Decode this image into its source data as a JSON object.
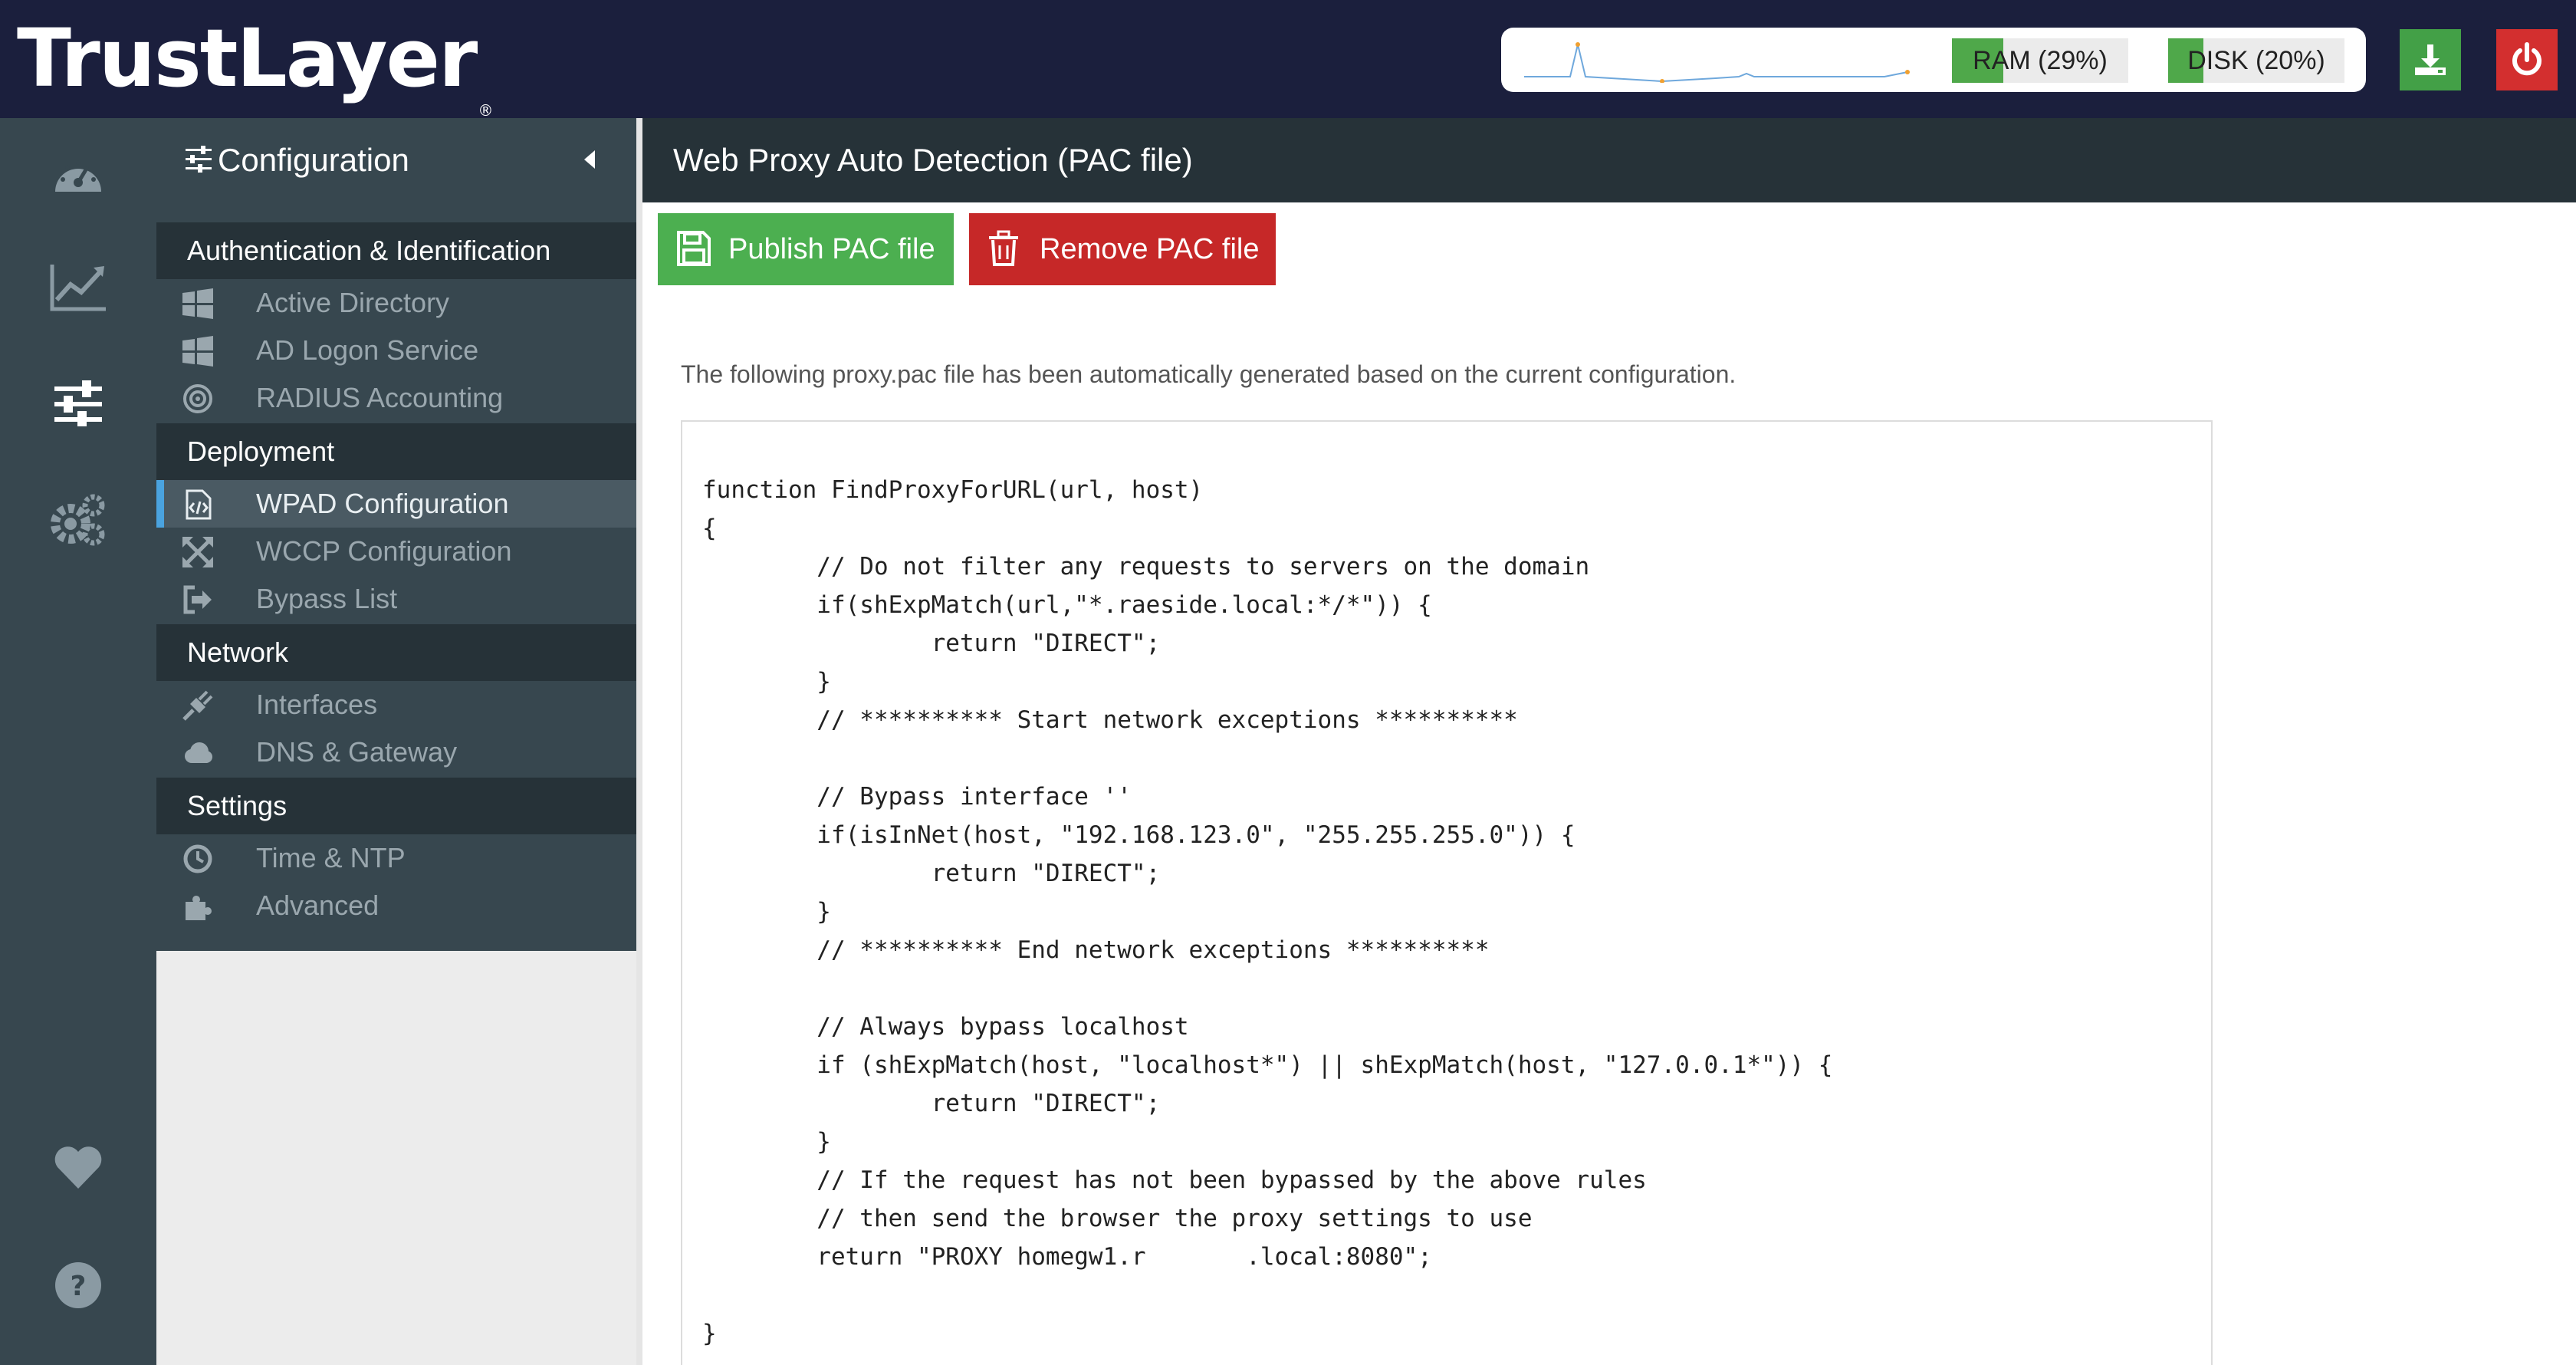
{
  "app": {
    "logo_text": "TrustLayer",
    "logo_mark": "®"
  },
  "status": {
    "ram_label": "RAM (29%)",
    "ram_percent": 29,
    "disk_label": "DISK (20%)",
    "disk_percent": 20
  },
  "top_actions": {
    "download_icon": "download-icon",
    "power_icon": "power-icon"
  },
  "rail": {
    "icons": [
      "dashboard-icon",
      "chart-icon",
      "sliders-icon",
      "gears-icon",
      "heart-icon",
      "help-icon"
    ]
  },
  "sidebar": {
    "title": "Configuration",
    "sections": [
      {
        "label": "Authentication & Identification",
        "items": [
          {
            "label": "Active Directory",
            "icon": "windows-icon"
          },
          {
            "label": "AD Logon Service",
            "icon": "windows-icon"
          },
          {
            "label": "RADIUS Accounting",
            "icon": "target-icon"
          }
        ]
      },
      {
        "label": "Deployment",
        "items": [
          {
            "label": "WPAD Configuration",
            "icon": "code-file-icon",
            "active": true
          },
          {
            "label": "WCCP Configuration",
            "icon": "arrows-icon"
          },
          {
            "label": "Bypass List",
            "icon": "sign-out-icon"
          }
        ]
      },
      {
        "label": "Network",
        "items": [
          {
            "label": "Interfaces",
            "icon": "plug-icon"
          },
          {
            "label": "DNS & Gateway",
            "icon": "cloud-icon"
          }
        ]
      },
      {
        "label": "Settings",
        "items": [
          {
            "label": "Time & NTP",
            "icon": "clock-icon"
          },
          {
            "label": "Advanced",
            "icon": "puzzle-icon"
          }
        ]
      }
    ]
  },
  "main": {
    "title": "Web Proxy Auto Detection (PAC file)",
    "publish_label": "Publish PAC file",
    "remove_label": "Remove PAC file",
    "description": "The following proxy.pac file has been automatically generated based on the current configuration.",
    "pac_code": "function FindProxyForURL(url, host)\n{\n        // Do not filter any requests to servers on the domain\n        if(shExpMatch(url,\"*.raeside.local:*/*\")) {\n                return \"DIRECT\";\n        }\n        // ********** Start network exceptions **********\n\n        // Bypass interface ''\n        if(isInNet(host, \"192.168.123.0\", \"255.255.255.0\")) {\n                return \"DIRECT\";\n        }\n        // ********** End network exceptions **********\n\n        // Always bypass localhost\n        if (shExpMatch(host, \"localhost*\") || shExpMatch(host, \"127.0.0.1*\")) {\n                return \"DIRECT\";\n        }\n        // If the request has not been bypassed by the above rules\n        // then send the browser the proxy settings to use\n        return \"PROXY homegw1.r       .local:8080\";\n\n}"
  }
}
